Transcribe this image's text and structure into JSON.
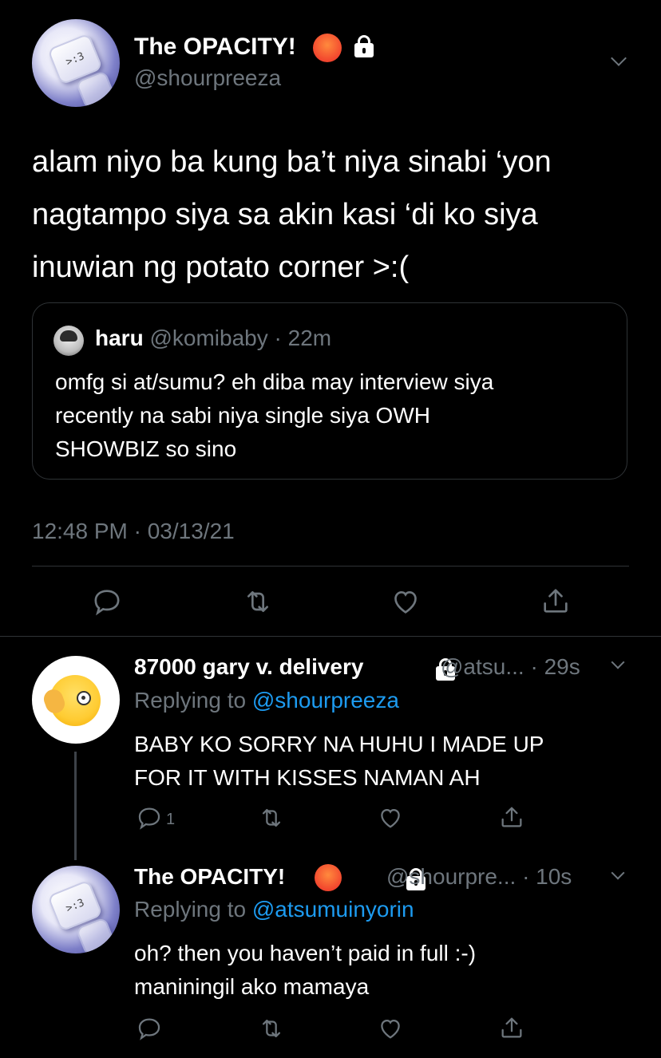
{
  "main_tweet": {
    "display_name": "The OPACITY!",
    "handle": "@shourpreeza",
    "body_lines": [
      "alam niyo ba kung ba’t niya sinabi ‘yon",
      "nagtampo siya sa akin kasi ‘di ko siya",
      "inuwian ng potato corner >:("
    ],
    "avatar_text": ">:3",
    "timestamp": "12:48 PM · 03/13/21",
    "quote": {
      "display_name": "haru",
      "handle": "@komibaby",
      "time": "· 22m",
      "body_lines": [
        "omfg si at/sumu? eh diba may interview siya",
        "recently na sabi niya single siya OWH",
        "SHOWBIZ so sino"
      ]
    }
  },
  "replies": [
    {
      "display_name": "87000 gary v. delivery",
      "handle": "@atsu...",
      "time": "· 29s",
      "replying_prefix": "Replying to",
      "replying_to": "@shourpreeza",
      "body_lines": [
        "BABY KO SORRY NA HUHU I MADE UP",
        "FOR IT WITH KISSES NAMAN AH"
      ],
      "reply_count": "1"
    },
    {
      "display_name": "The OPACITY!",
      "handle": "@shourpre...",
      "time": "· 10s",
      "replying_prefix": "Replying to",
      "replying_to": "@atsumuinyorin",
      "body_lines": [
        "oh? then you haven’t paid in full :-)",
        "maniningil ako mamaya"
      ],
      "avatar_text": ">:3"
    }
  ],
  "icons": {
    "reply": "reply-icon",
    "retweet": "retweet-icon",
    "like": "heart-icon",
    "share": "share-icon",
    "lock": "lock-icon",
    "menu": "chevron-down-icon"
  },
  "colors": {
    "background": "#000000",
    "text": "#ffffff",
    "muted": "#6e767d",
    "link": "#1d9bf0",
    "divider": "#2f3336"
  }
}
